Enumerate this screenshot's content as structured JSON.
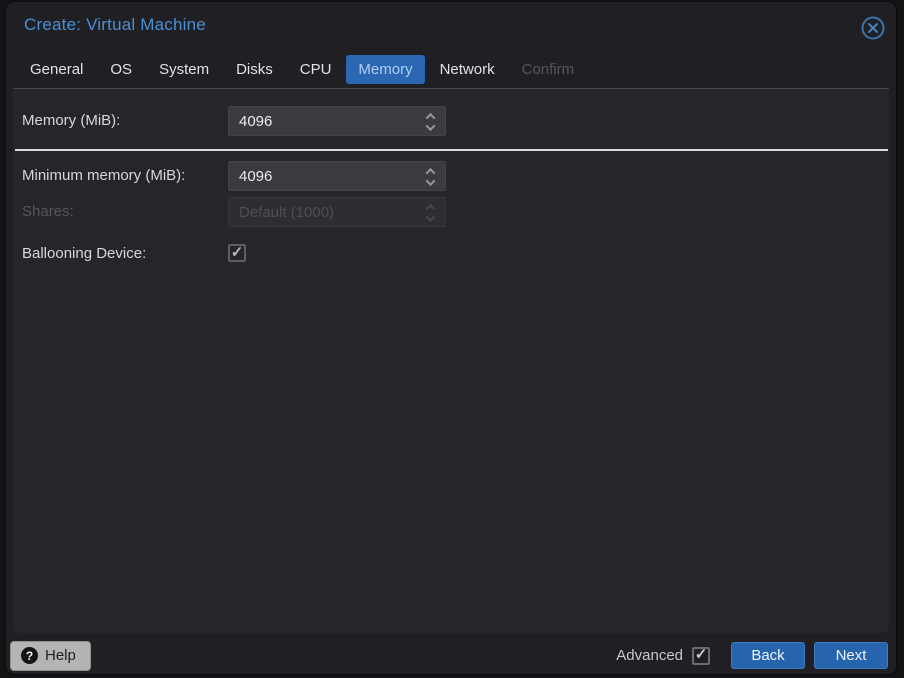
{
  "window": {
    "title": "Create: Virtual Machine"
  },
  "tabs": {
    "items": [
      {
        "label": "General",
        "state": "normal"
      },
      {
        "label": "OS",
        "state": "normal"
      },
      {
        "label": "System",
        "state": "normal"
      },
      {
        "label": "Disks",
        "state": "normal"
      },
      {
        "label": "CPU",
        "state": "normal"
      },
      {
        "label": "Memory",
        "state": "active"
      },
      {
        "label": "Network",
        "state": "normal"
      },
      {
        "label": "Confirm",
        "state": "disabled"
      }
    ]
  },
  "form": {
    "memory": {
      "label": "Memory (MiB):",
      "value": "4096",
      "enabled": true
    },
    "min_memory": {
      "label": "Minimum memory (MiB):",
      "value": "4096",
      "enabled": true
    },
    "shares": {
      "label": "Shares:",
      "value": "Default (1000)",
      "enabled": false
    },
    "ballooning": {
      "label": "Ballooning Device:",
      "checked": true
    }
  },
  "footer": {
    "help": "Help",
    "advanced": "Advanced",
    "advanced_checked": true,
    "back": "Back",
    "next": "Next"
  },
  "icons": {
    "help_glyph": "?",
    "check_glyph": "✓"
  },
  "colors": {
    "title_blue": "#4b8fd2",
    "active_tab_blue": "#2b67b2",
    "button_blue": "#2764ae",
    "window_bg": "#202024",
    "body_bg": "#26262a",
    "divider": "#d8d8d8"
  }
}
